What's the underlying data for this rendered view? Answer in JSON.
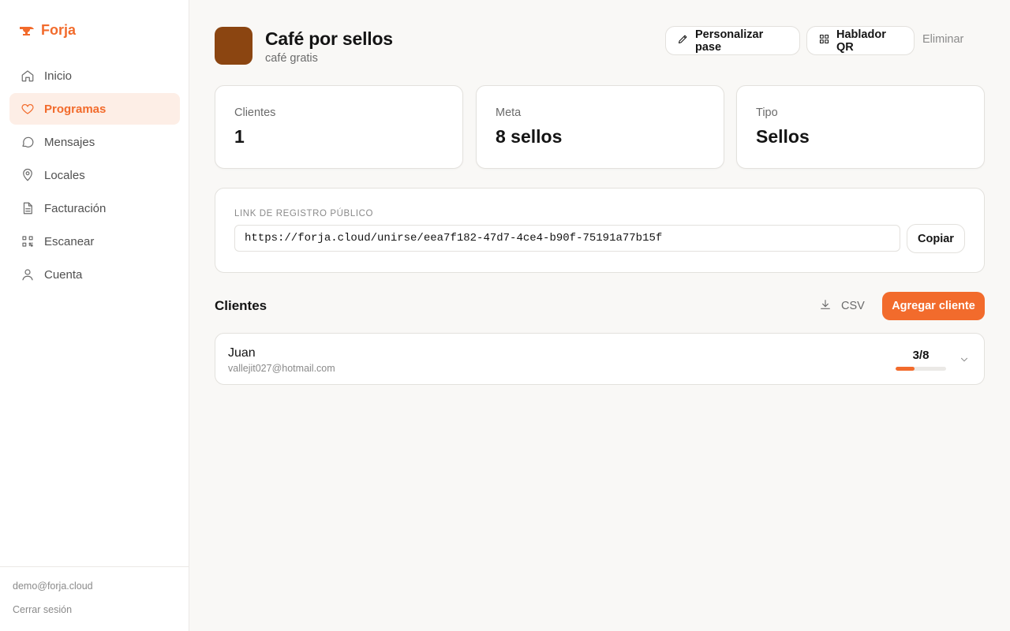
{
  "brand": {
    "name": "Forja",
    "accent": "#f26b2c",
    "icon": "anvil-icon"
  },
  "sidebar": {
    "items": [
      {
        "label": "Inicio",
        "icon": "home-icon",
        "active": false
      },
      {
        "label": "Programas",
        "icon": "heart-icon",
        "active": true
      },
      {
        "label": "Mensajes",
        "icon": "message-icon",
        "active": false
      },
      {
        "label": "Locales",
        "icon": "map-pin-icon",
        "active": false
      },
      {
        "label": "Facturación",
        "icon": "document-icon",
        "active": false
      },
      {
        "label": "Escanear",
        "icon": "scan-icon",
        "active": false
      },
      {
        "label": "Cuenta",
        "icon": "user-icon",
        "active": false
      }
    ],
    "user_email": "demo@forja.cloud",
    "logout_label": "Cerrar sesión"
  },
  "program": {
    "title": "Café por sellos",
    "subtitle": "café gratis",
    "thumbnail_color": "#8b4511",
    "actions": {
      "customize_label": "Personalizar pase",
      "qr_label": "Hablador QR",
      "delete_label": "Eliminar"
    }
  },
  "stats": [
    {
      "label": "Clientes",
      "value": "1"
    },
    {
      "label": "Meta",
      "value": "8 sellos"
    },
    {
      "label": "Tipo",
      "value": "Sellos"
    }
  ],
  "registration": {
    "label": "LINK DE REGISTRO PÚBLICO",
    "url": "https://forja.cloud/unirse/eea7f182-47d7-4ce4-b90f-75191a77b15f",
    "copy_label": "Copiar"
  },
  "clients": {
    "title": "Clientes",
    "csv_label": "CSV",
    "add_label": "Agregar cliente",
    "rows": [
      {
        "name": "Juan",
        "email": "vallejit027@hotmail.com",
        "progress_text": "3/8",
        "stamps": 3,
        "goal": 8
      }
    ]
  }
}
